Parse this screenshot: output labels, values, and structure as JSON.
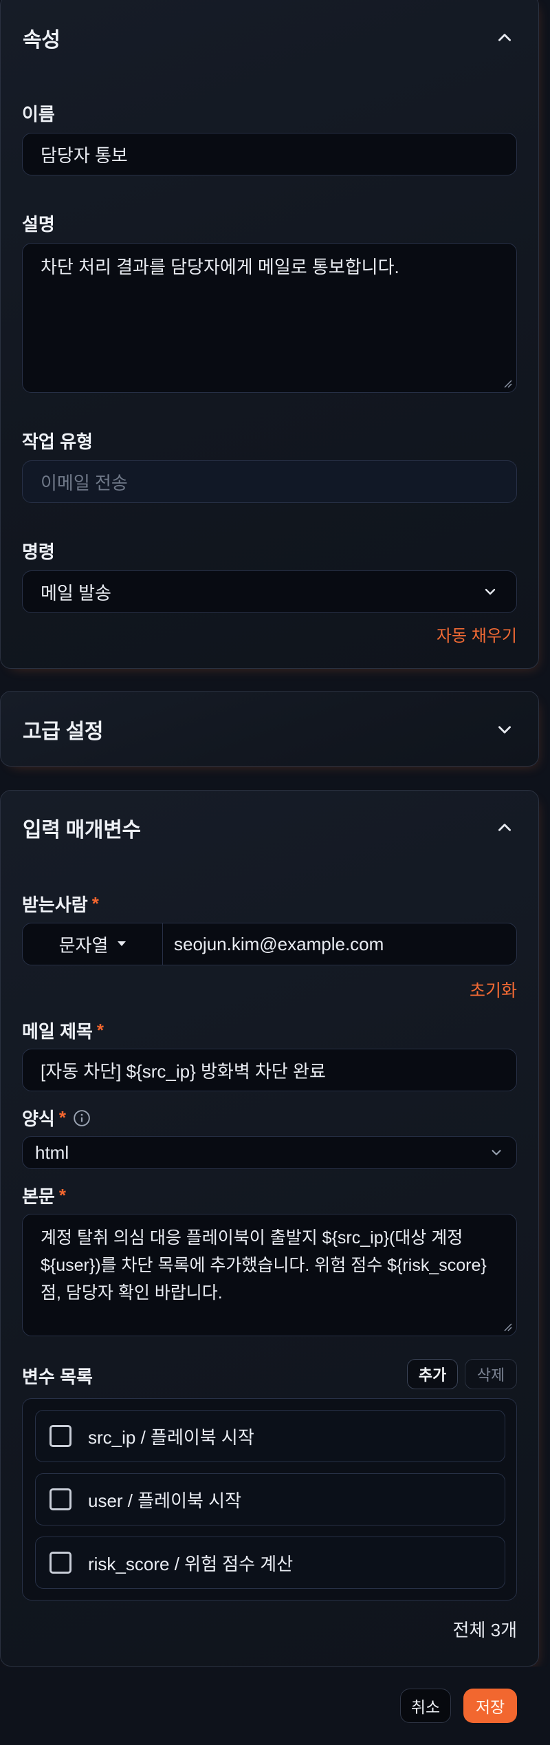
{
  "properties": {
    "title": "속성",
    "name_label": "이름",
    "name_value": "담당자 통보",
    "desc_label": "설명",
    "desc_value": "차단 처리 결과를 담당자에게 메일로 통보합니다.",
    "type_label": "작업 유형",
    "type_placeholder": "이메일 전송",
    "command_label": "명령",
    "command_value": "메일 발송",
    "autofill": "자동 채우기"
  },
  "advanced": {
    "title": "고급 설정"
  },
  "inputs": {
    "title": "입력 매개변수",
    "recipient_label": "받는사람",
    "required_mark": "*",
    "recipient_type": "문자열",
    "recipient_value": "seojun.kim@example.com",
    "reset": "초기화",
    "subject_label": "메일 제목",
    "subject_value": "[자동 차단] ${src_ip} 방화벽 차단 완료",
    "format_label": "양식",
    "format_value": "html",
    "body_label": "본문",
    "body_value": "계정 탈취 의심 대응 플레이북이 출발지 ${src_ip}(대상 계정 ${user})를 차단 목록에 추가했습니다. 위험 점수 ${risk_score}점, 담당자 확인 바랍니다.",
    "vars_label": "변수 목록",
    "add": "추가",
    "delete": "삭제",
    "vars": [
      {
        "label": "src_ip / 플레이북 시작",
        "checked": false
      },
      {
        "label": "user / 플레이북 시작",
        "checked": false
      },
      {
        "label": "risk_score / 위험 점수 계산",
        "checked": false
      }
    ],
    "total": "전체 3개"
  },
  "footer": {
    "cancel": "취소",
    "save": "저장"
  },
  "colors": {
    "accent": "#f26a34",
    "background": "#0e121b"
  }
}
